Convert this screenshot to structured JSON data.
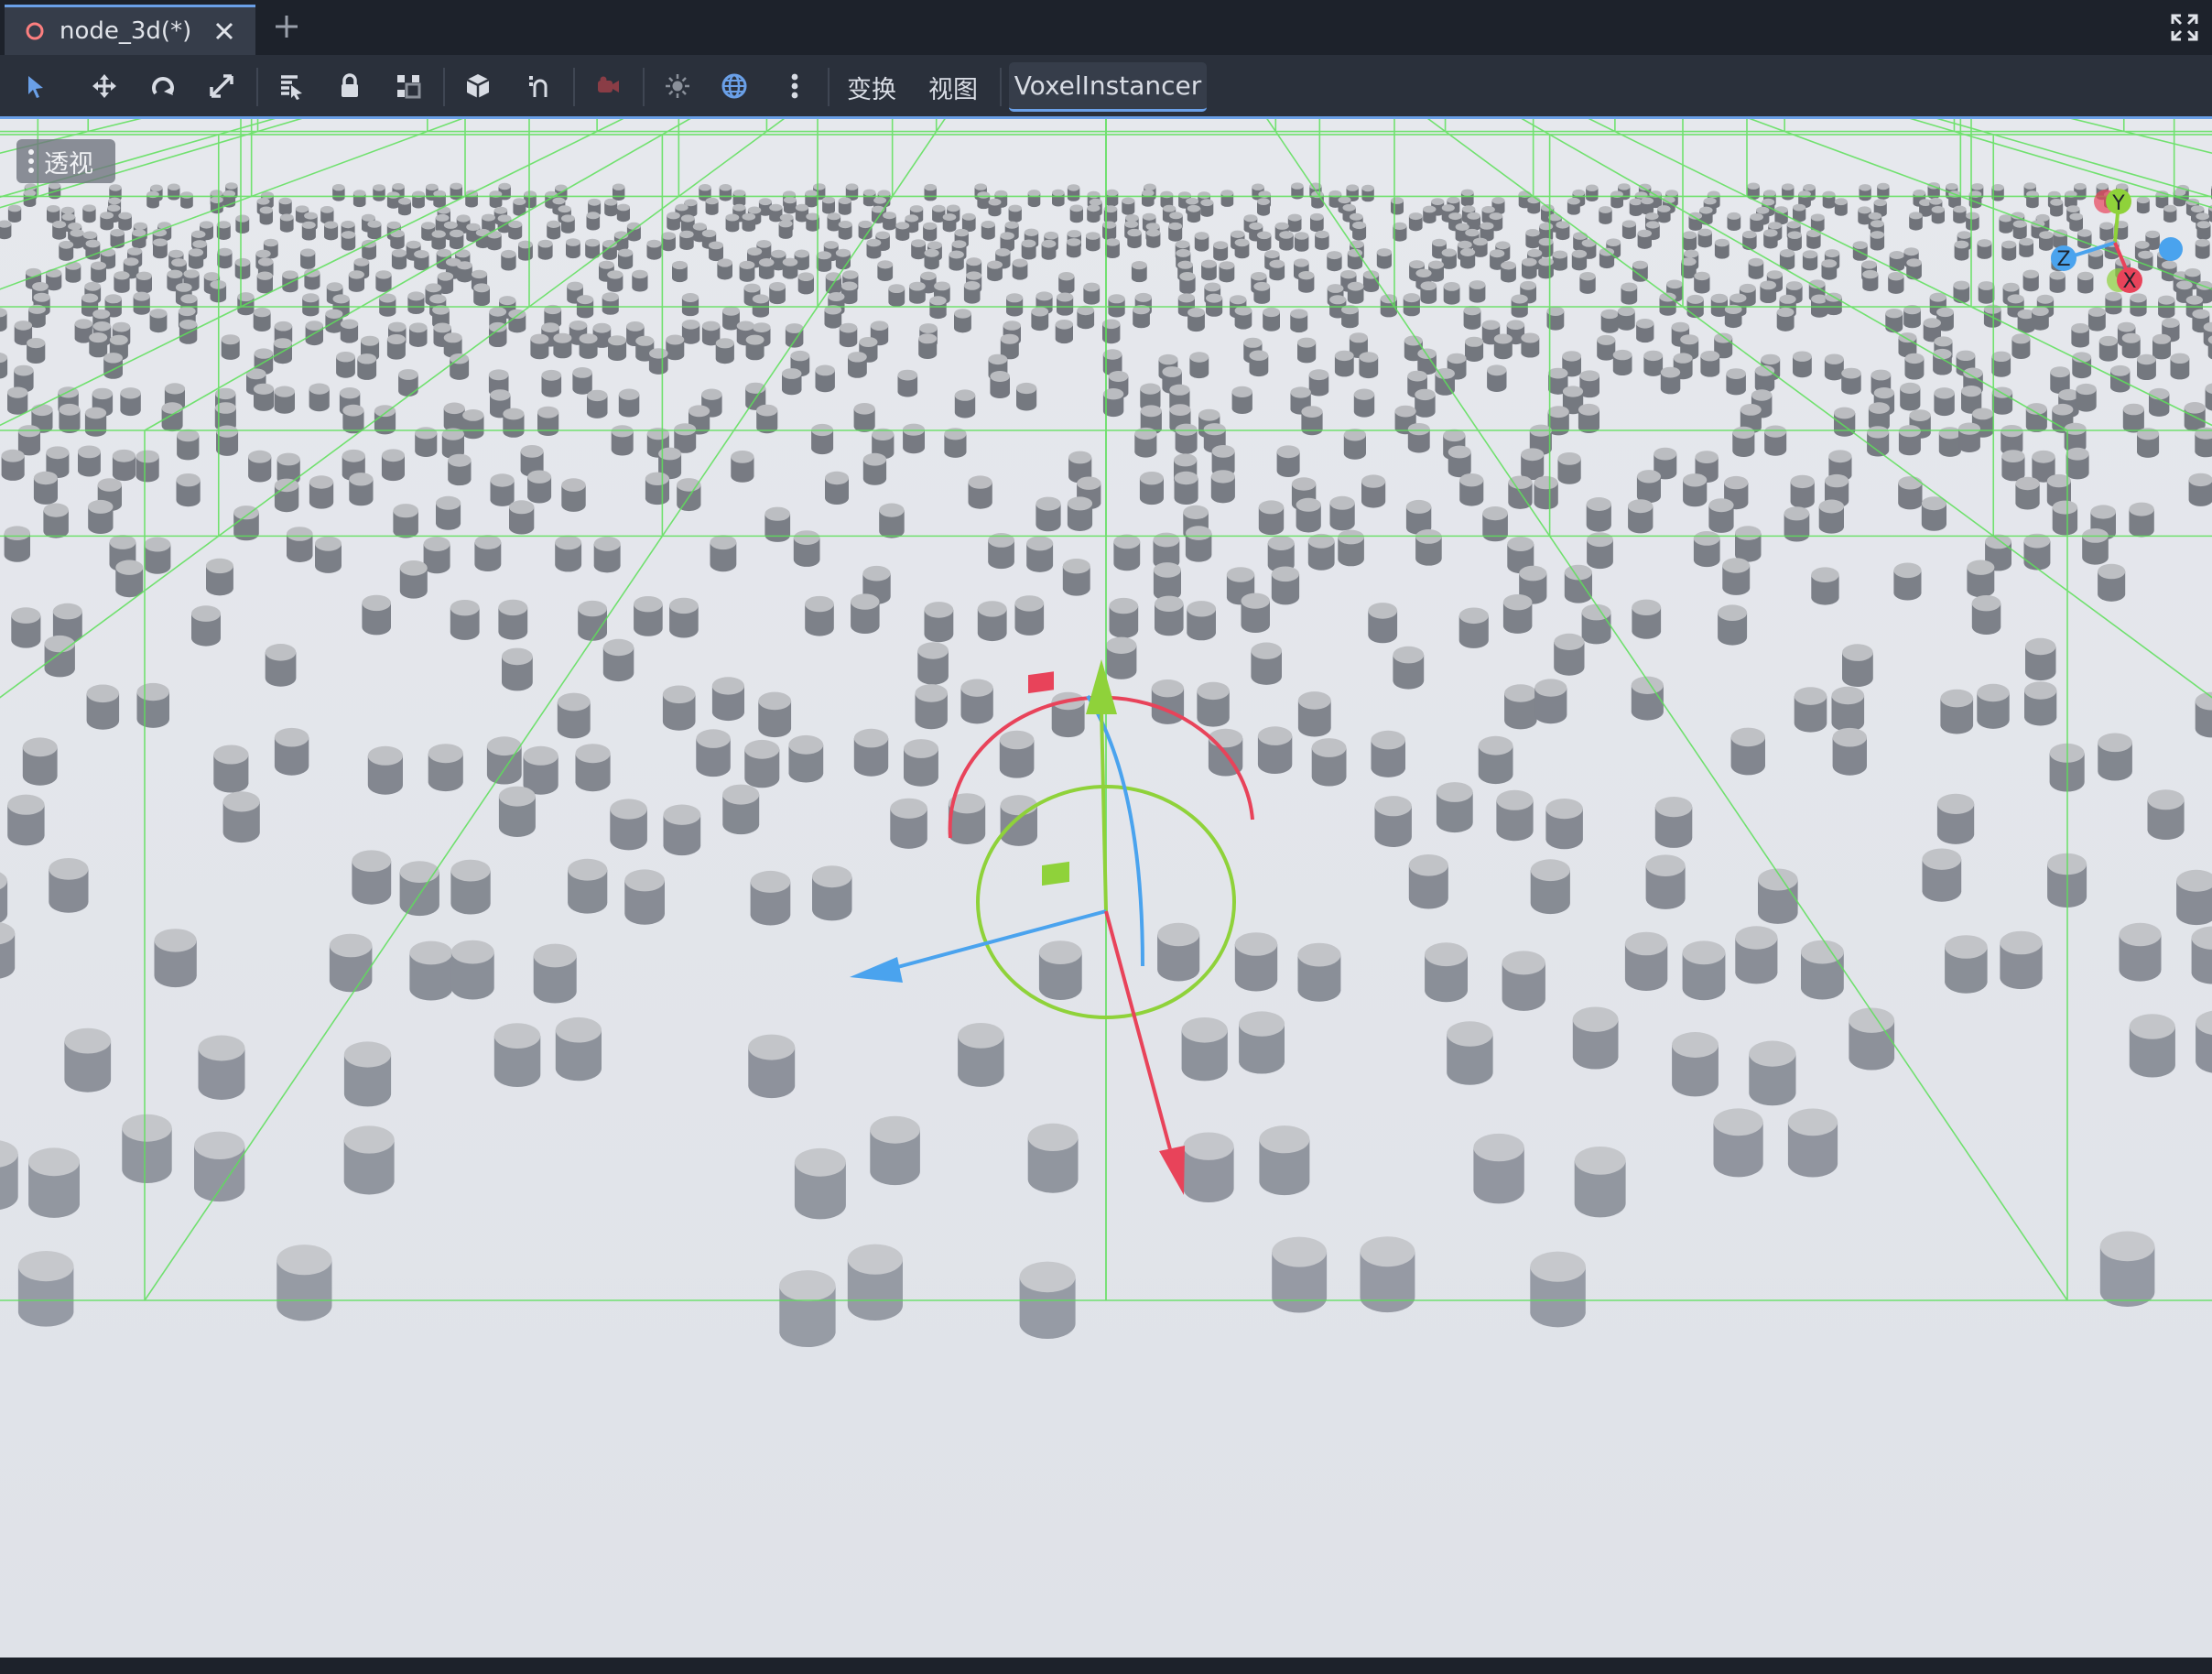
{
  "scene_tab": {
    "title": "node_3d(*)",
    "icon": "node-3d-circle-icon",
    "close_icon": "close-icon"
  },
  "tabbar": {
    "add_tab_icon": "plus-icon",
    "distraction_free_icon": "expand-icon"
  },
  "toolbar": {
    "tools": [
      "select-tool-icon",
      "move-tool-icon",
      "rotate-tool-icon",
      "scale-tool-icon",
      "list-select-icon",
      "lock-icon",
      "group-icon",
      "local-space-icon",
      "snap-icon",
      "camera-preview-icon",
      "sun-preview-icon",
      "environment-preview-icon",
      "more-options-icon"
    ],
    "transform_menu": "变换",
    "view_menu": "视图",
    "plugin_button": "VoxelInstancer"
  },
  "viewport": {
    "perspective_label": "透视",
    "gizmo_axes": {
      "y": "Y",
      "z": "Z",
      "x": "X"
    },
    "colors": {
      "background": "#e3e6ec",
      "grid": "#5de05a",
      "instance_top": "#c2c4c8",
      "instance_side": "#7c8088",
      "axis_x": "#e8435a",
      "axis_y": "#8fd23a",
      "axis_z": "#4aa3ee"
    }
  },
  "colors": {
    "accent": "#6aa0e8",
    "toolbar_bg": "#2a303b",
    "tabbar_bg": "#1d222b"
  }
}
